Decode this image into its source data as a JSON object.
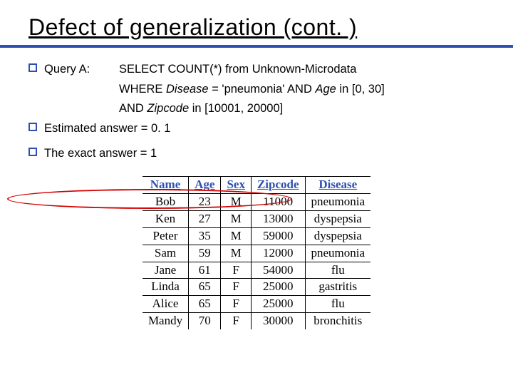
{
  "title": "Defect of generalization (cont. )",
  "bullets": {
    "queryA_label": "Query A:",
    "queryA_line1": "SELECT COUNT(*) from Unknown-Microdata",
    "queryA_line2_a": "WHERE ",
    "queryA_line2_disease": "Disease",
    "queryA_line2_b": " = 'pneumonia' AND ",
    "queryA_line2_age": "Age",
    "queryA_line2_c": " in [0, 30]",
    "queryA_line3_a": "AND ",
    "queryA_line3_zip": "Zipcode",
    "queryA_line3_b": " in [10001, 20000]",
    "estimated": "Estimated answer =  0. 1",
    "exact": "The exact answer = 1"
  },
  "table": {
    "headers": [
      "Name",
      "Age",
      "Sex",
      "Zipcode",
      "Disease"
    ],
    "rows": [
      [
        "Bob",
        "23",
        "M",
        "11000",
        "pneumonia"
      ],
      [
        "Ken",
        "27",
        "M",
        "13000",
        "dyspepsia"
      ],
      [
        "Peter",
        "35",
        "M",
        "59000",
        "dyspepsia"
      ],
      [
        "Sam",
        "59",
        "M",
        "12000",
        "pneumonia"
      ],
      [
        "Jane",
        "61",
        "F",
        "54000",
        "flu"
      ],
      [
        "Linda",
        "65",
        "F",
        "25000",
        "gastritis"
      ],
      [
        "Alice",
        "65",
        "F",
        "25000",
        "flu"
      ],
      [
        "Mandy",
        "70",
        "F",
        "30000",
        "bronchitis"
      ]
    ]
  },
  "highlight_row_index": 0
}
